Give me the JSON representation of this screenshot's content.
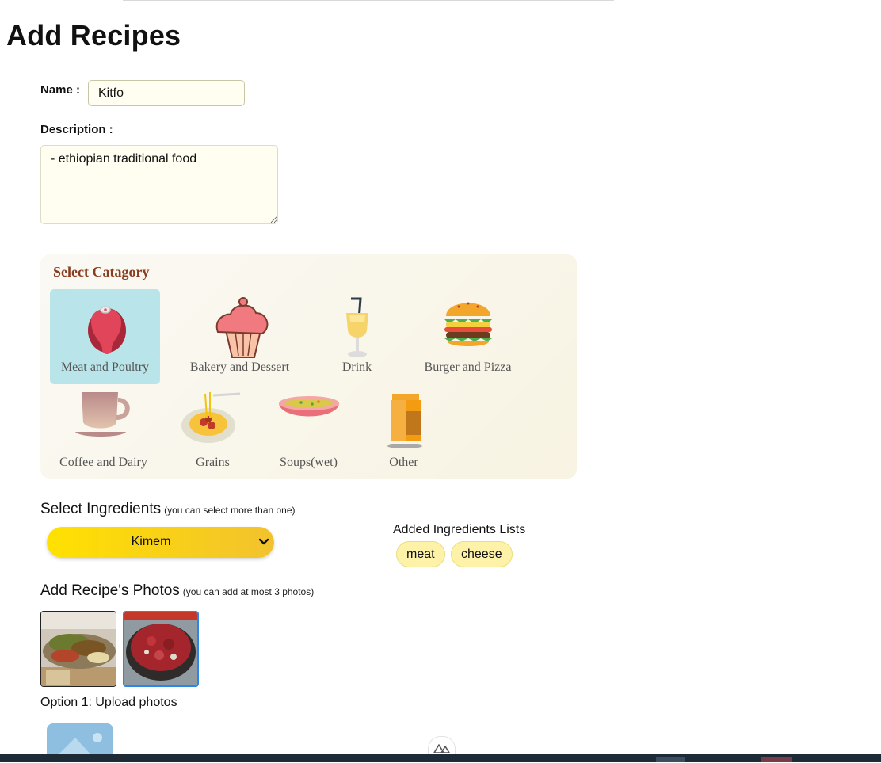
{
  "page": {
    "title": "Add Recipes"
  },
  "form": {
    "name_label": "Name :",
    "name_value": "Kitfo",
    "description_label": "Description :",
    "description_value": "- ethiopian traditional food"
  },
  "category": {
    "title": "Select Catagory",
    "selected": "Meat and Poultry",
    "items": [
      {
        "label": "Meat and Poultry",
        "icon": "meat-icon"
      },
      {
        "label": "Bakery and Dessert",
        "icon": "cupcake-icon"
      },
      {
        "label": "Drink",
        "icon": "drink-icon"
      },
      {
        "label": "Burger and Pizza",
        "icon": "burger-icon"
      },
      {
        "label": "Coffee and Dairy",
        "icon": "coffee-cup-icon"
      },
      {
        "label": "Grains",
        "icon": "pasta-plate-icon"
      },
      {
        "label": "Soups(wet)",
        "icon": "soup-bowl-icon"
      },
      {
        "label": "Other",
        "icon": "juice-box-icon"
      }
    ]
  },
  "ingredients": {
    "title": "Select Ingredients",
    "hint": "(you can select more than one)",
    "select_value": "Kimem",
    "added_title": "Added Ingredients Lists",
    "added": [
      "meat",
      "cheese"
    ]
  },
  "photos": {
    "title": "Add Recipe's Photos",
    "hint": "(you can add at most 3 photos)",
    "option1": "Option 1: Upload photos"
  },
  "colors": {
    "selected_category_bg": "#b9e5ea",
    "category_title": "#8a3d1e",
    "chip_bg": "#fdf2a8",
    "select_gradient_start": "#ffe100",
    "select_gradient_end": "#f2c22e",
    "selected_photo_border": "#2a86e8"
  }
}
